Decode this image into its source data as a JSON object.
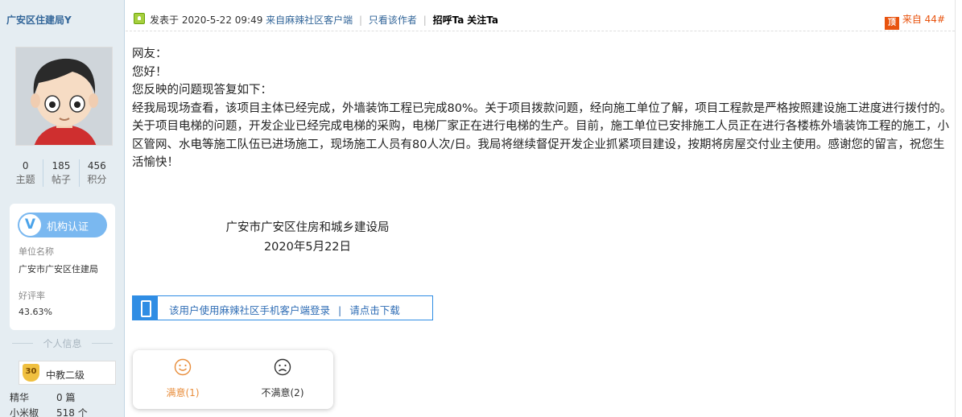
{
  "user": {
    "name": "广安区住建局",
    "name_suffix": "Y",
    "stats": [
      {
        "value": "0",
        "label": "主题"
      },
      {
        "value": "185",
        "label": "帖子"
      },
      {
        "value": "456",
        "label": "积分"
      }
    ],
    "org_badge": "机构认证",
    "org_badge_icon": "V",
    "unit_label": "单位名称",
    "unit_value": "广安市广安区住建局",
    "rating_label": "好评率",
    "rating_value": "43.63%",
    "info_heading": "个人信息",
    "rank_level": "30",
    "rank_name": "中教二级",
    "extra_stats": [
      {
        "key": "精华",
        "value": "0 篇"
      },
      {
        "key": "小米椒",
        "value": "518 个"
      }
    ]
  },
  "post_header": {
    "posted_prefix": "发表于",
    "posted_time": "2020-5-22 09:49",
    "source": "来自麻辣社区客户端",
    "only_author": "只看该作者",
    "greet": "招呼Ta",
    "follow": "关注Ta",
    "floor_badge": "顶",
    "floor": "来自 44#"
  },
  "post": {
    "paragraphs": [
      "网友：",
      "您好！",
      "您反映的问题现答复如下：",
      "经我局现场查看，该项目主体已经完成，外墙装饰工程已完成80%。关于项目拨款问题，经向施工单位了解，项目工程款是严格按照建设施工进度进行拨付的。关于项目电梯的问题，开发企业已经完成电梯的采购，电梯厂家正在进行电梯的生产。目前，施工单位已安排施工人员正在进行各楼栋外墙装饰工程的施工，小区管网、水电等施工队伍已进场施工，现场施工人员有80人次/日。我局将继续督促开发企业抓紧项目建设，按期将房屋交付业主使用。感谢您的留言，祝您生活愉快！"
    ],
    "signature_org": "广安市广安区住房和城乡建设局",
    "signature_date": "2020年5月22日"
  },
  "app_bar": {
    "text": "该用户使用麻辣社区手机客户端登录",
    "separator": "|",
    "link": "请点击下载"
  },
  "rating": {
    "satisfied": "满意(1)",
    "unsatisfied": "不满意(2)"
  },
  "colors": {
    "accent_blue": "#2f8de4",
    "satisfied_orange": "#e88d3b",
    "floor_orange": "#e8530e"
  }
}
